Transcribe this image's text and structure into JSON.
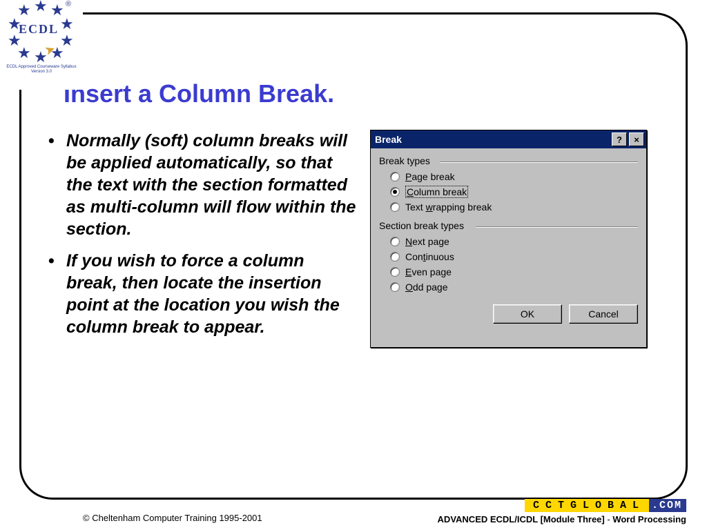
{
  "logo": {
    "text": "ECDL",
    "sub": "ECDL Approved Courseware Syllabus Version 3.0",
    "reg": "®"
  },
  "title": "Insert a Column Break.",
  "bullets": [
    "Normally (soft) column breaks will be applied automatically, so that the text with the section formatted as multi-column will flow within the section.",
    "If you wish to force a column break, then locate the insertion point at the location you wish the column break to appear."
  ],
  "dialog": {
    "title": "Break",
    "help_symbol": "?",
    "close_symbol": "×",
    "group1_label": "Break types",
    "group2_label": "Section break types",
    "break_types": [
      {
        "pre": "",
        "u": "P",
        "post": "age break",
        "checked": false,
        "selected": false
      },
      {
        "pre": "",
        "u": "C",
        "post": "olumn break",
        "checked": true,
        "selected": true
      },
      {
        "pre": "Text ",
        "u": "w",
        "post": "rapping break",
        "checked": false,
        "selected": false
      }
    ],
    "section_types": [
      {
        "pre": "",
        "u": "N",
        "post": "ext page",
        "checked": false
      },
      {
        "pre": "Con",
        "u": "t",
        "post": "inuous",
        "checked": false
      },
      {
        "pre": "",
        "u": "E",
        "post": "ven page",
        "checked": false
      },
      {
        "pre": "",
        "u": "O",
        "post": "dd page",
        "checked": false
      }
    ],
    "ok": "OK",
    "cancel": "Cancel"
  },
  "footer": {
    "copyright": "© Cheltenham Computer Training 1995-2001",
    "brand_a": "CCTGLOBAL",
    "brand_b": ".COM",
    "module_prefix": "ADVANCED ECDL/ICDL [Module Three]",
    "module_sep": " - ",
    "module_suffix": "Word Processing"
  }
}
